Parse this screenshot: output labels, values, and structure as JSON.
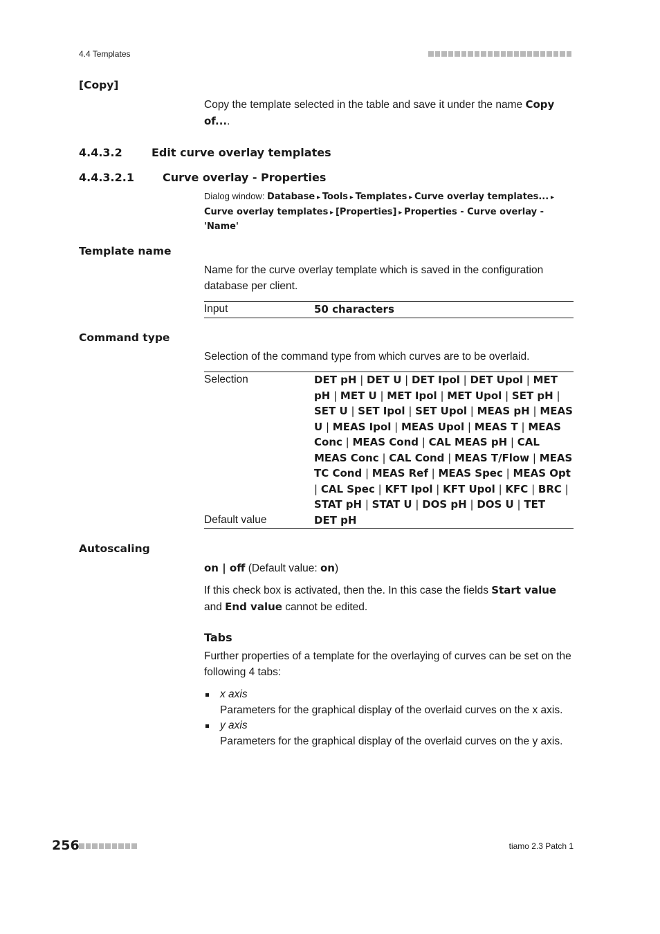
{
  "header": {
    "section": "4.4 Templates",
    "dots_count": 22
  },
  "copy": {
    "label": "[Copy]",
    "text_pre": "Copy the template selected in the table and save it under the name ",
    "text_bold": "Copy of...",
    "text_post": "."
  },
  "sections": {
    "h3_num": "4.4.3.2",
    "h3_title": "Edit curve overlay templates",
    "h4_num": "4.4.3.2.1",
    "h4_title": "Curve overlay - Properties"
  },
  "dialog_path": {
    "prefix": "Dialog window: ",
    "items": [
      "Database",
      "Tools",
      "Templates",
      "Curve overlay templates...",
      "Curve overlay templates",
      "[Properties]",
      "Properties - Curve overlay - 'Name'"
    ],
    "separator": "▸"
  },
  "template_name": {
    "label": "Template name",
    "description": "Name for the curve overlay template which is saved in the configuration database per client.",
    "table": [
      {
        "key": "Input",
        "value": "50 characters"
      }
    ]
  },
  "command_type": {
    "label": "Command type",
    "description": "Selection of the command type from which curves are to be overlaid.",
    "selection_label": "Selection",
    "options": [
      "DET pH",
      "DET U",
      "DET Ipol",
      "DET Upol",
      "MET pH",
      "MET U",
      "MET Ipol",
      "MET Upol",
      "SET pH",
      "SET U",
      "SET Ipol",
      "SET Upol",
      "MEAS pH",
      "MEAS U",
      "MEAS Ipol",
      "MEAS Upol",
      "MEAS T",
      "MEAS Conc",
      "MEAS Cond",
      "CAL MEAS pH",
      "CAL MEAS Conc",
      "CAL Cond",
      "MEAS T/Flow",
      "MEAS TC Cond",
      "MEAS Ref",
      "MEAS Spec",
      "MEAS Opt",
      "CAL Spec",
      "KFT Ipol",
      "KFT Upol",
      "KFC",
      "BRC",
      "STAT pH",
      "STAT U",
      "DOS pH",
      "DOS U",
      "TET"
    ],
    "default_label": "Default value",
    "default_value": "DET pH"
  },
  "autoscaling": {
    "label": "Autoscaling",
    "on": "on",
    "off": "off",
    "default_pre": " (Default value: ",
    "default_value": "on",
    "default_post": ")",
    "desc_pre": "If this check box is activated, then the. In this case the fields ",
    "start_value": "Start value",
    "desc_mid": " and ",
    "end_value": "End value",
    "desc_post": " cannot be edited."
  },
  "tabs": {
    "heading": "Tabs",
    "intro": "Further properties of a template for the overlaying of curves can be set on the following 4 tabs:",
    "items": [
      {
        "name": "x axis",
        "desc": "Parameters for the graphical display of the overlaid curves on the x axis."
      },
      {
        "name": "y axis",
        "desc": "Parameters for the graphical display of the overlaid curves on the y axis."
      }
    ]
  },
  "footer": {
    "page_number": "256",
    "dots_count": 9,
    "product": "tiamo 2.3 Patch 1"
  }
}
